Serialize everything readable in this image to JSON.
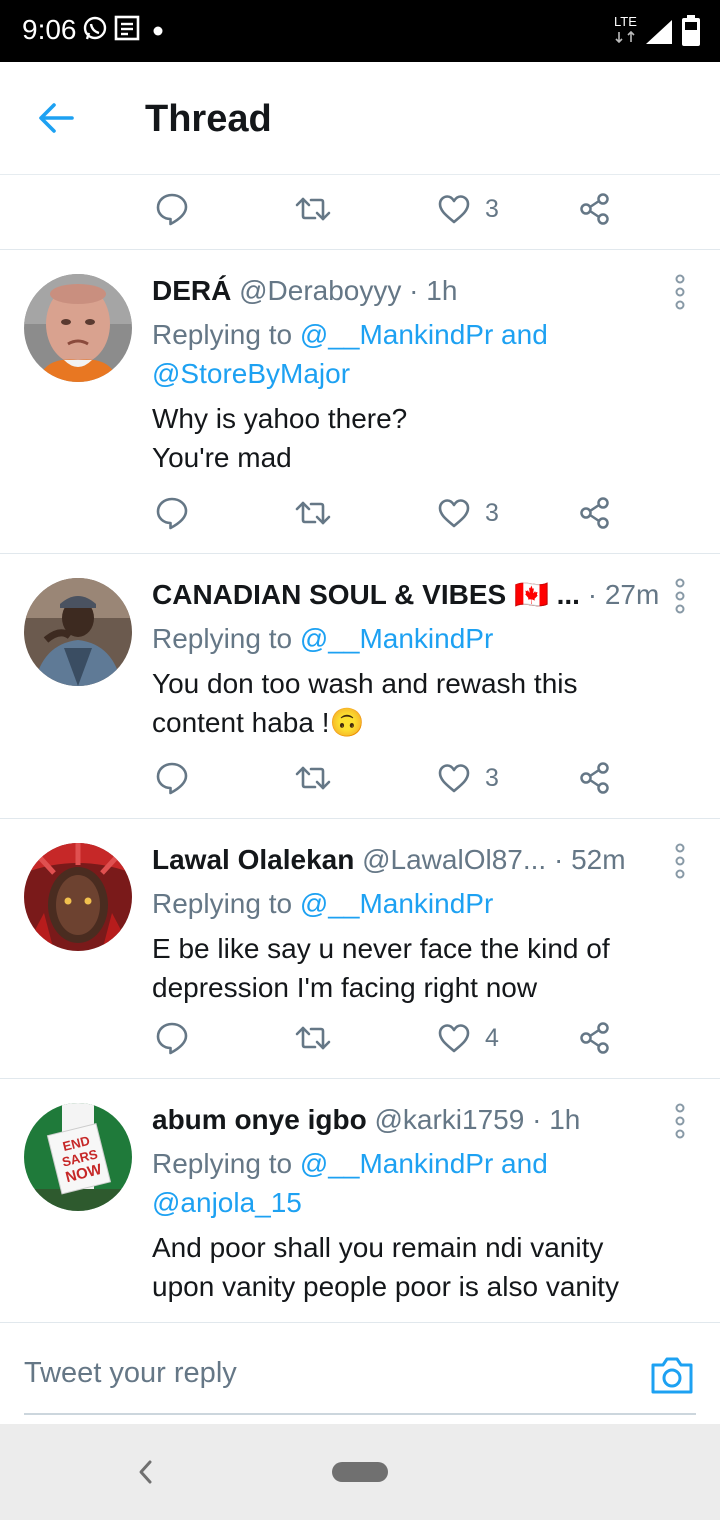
{
  "status_bar": {
    "time": "9:06",
    "network": "LTE"
  },
  "header": {
    "title": "Thread"
  },
  "colors": {
    "accent": "#1da1f2",
    "text": "#14171a",
    "muted": "#657786"
  },
  "top_actions": {
    "like_count": "3"
  },
  "tweets": [
    {
      "name": "DERÁ",
      "handle": "@Deraboyyy",
      "time": "· 1h",
      "reply_prefix": "Replying to",
      "reply_line1": "@__MankindPr and",
      "reply_line2": "@StoreByMajor",
      "text_line1": "Why is yahoo there?",
      "text_line2": "You're mad",
      "like_count": "3"
    },
    {
      "name": "CANADIAN SOUL & VIBES 🇨🇦 ...",
      "handle": "",
      "time": "· 27m",
      "reply_prefix": "Replying to",
      "reply_line1": "@__MankindPr",
      "text_line1": "You don too wash and rewash this",
      "text_line2": "content haba !🙃",
      "like_count": "3"
    },
    {
      "name": "Lawal Olalekan",
      "handle": "@LawalOl87...",
      "time": "· 52m",
      "reply_prefix": "Replying to",
      "reply_line1": "@__MankindPr",
      "text_line1": "E be like say u never face the kind of",
      "text_line2": "depression I'm facing right now",
      "like_count": "4"
    },
    {
      "name": "abum onye igbo",
      "handle": "@karki1759",
      "time": "· 1h",
      "reply_prefix": "Replying to",
      "reply_line1": "@__MankindPr and",
      "reply_line2": "@anjola_15",
      "text_line1": "And poor shall you remain ndi vanity",
      "text_line2": "upon vanity people poor is also vanity",
      "avatar_sign": "END SARS NOW"
    }
  ],
  "composer": {
    "placeholder": "Tweet your reply"
  },
  "icons": [
    "back-arrow-icon",
    "reply-icon",
    "retweet-icon",
    "like-icon",
    "share-icon",
    "more-options-icon",
    "camera-icon",
    "whatsapp-icon",
    "news-icon",
    "signal-icon",
    "battery-icon"
  ]
}
